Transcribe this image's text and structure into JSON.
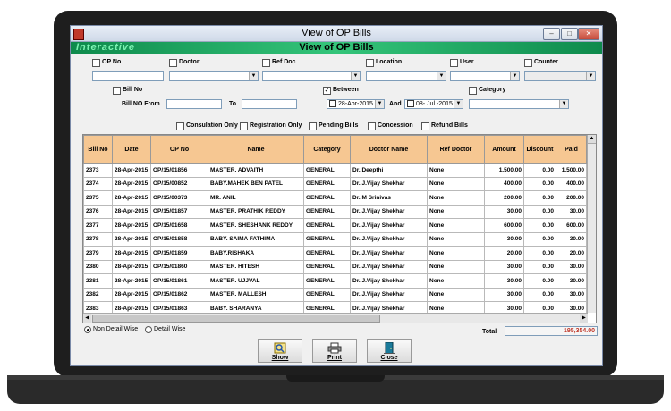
{
  "window": {
    "title": "View of OP Bills"
  },
  "banner": {
    "brand": "Interactive",
    "title": "View of  OP Bills"
  },
  "filters": {
    "op_no": "OP No",
    "doctor": "Doctor",
    "ref_doc": "Ref Doc",
    "location": "Location",
    "user": "User",
    "counter": "Counter",
    "bill_no": "Bill No",
    "bill_no_from": "Bill NO   From",
    "to": "To",
    "between": "Between",
    "date_from": "28-Apr-2015",
    "and": "And",
    "date_to": "08- Jul -2015",
    "category": "Category",
    "consultation_only": "Consulation Only",
    "registration_only": "Registration Only",
    "pending_bills": "Pending Bills",
    "concession": "Concession",
    "refund_bills": "Refund Bills"
  },
  "table": {
    "headers": [
      "Bill No",
      "Date",
      "OP No",
      "Name",
      "Category",
      "Doctor Name",
      "Ref Doctor",
      "Amount",
      "Discount",
      "Paid"
    ],
    "rows": [
      [
        "2373",
        "28-Apr-2015",
        "OP/15/01856",
        "MASTER. ADVAITH",
        "GENERAL",
        "Dr. Deepthi",
        "None",
        "1,500.00",
        "0.00",
        "1,500.00"
      ],
      [
        "2374",
        "28-Apr-2015",
        "OP/15/00852",
        "BABY.MAHEK BEN PATEL",
        "GENERAL",
        "Dr. J.Vijay Shekhar",
        "None",
        "400.00",
        "0.00",
        "400.00"
      ],
      [
        "2375",
        "28-Apr-2015",
        "OP/15/00373",
        "MR. ANIL",
        "GENERAL",
        "Dr. M Srinivas",
        "None",
        "200.00",
        "0.00",
        "200.00"
      ],
      [
        "2376",
        "28-Apr-2015",
        "OP/15/01857",
        "MASTER. PRATHIK REDDY",
        "GENERAL",
        "Dr. J.Vijay Shekhar",
        "None",
        "30.00",
        "0.00",
        "30.00"
      ],
      [
        "2377",
        "28-Apr-2015",
        "OP/15/01658",
        "MASTER. SHESHANK REDDY",
        "GENERAL",
        "Dr. J.Vijay Shekhar",
        "None",
        "600.00",
        "0.00",
        "600.00"
      ],
      [
        "2378",
        "28-Apr-2015",
        "OP/15/01858",
        "BABY. SAIMA FATHIMA",
        "GENERAL",
        "Dr. J.Vijay Shekhar",
        "None",
        "30.00",
        "0.00",
        "30.00"
      ],
      [
        "2379",
        "28-Apr-2015",
        "OP/15/01859",
        "BABY.RISHAKA",
        "GENERAL",
        "Dr. J.Vijay Shekhar",
        "None",
        "20.00",
        "0.00",
        "20.00"
      ],
      [
        "2380",
        "28-Apr-2015",
        "OP/15/01860",
        "MASTER. HITESH",
        "GENERAL",
        "Dr. J.Vijay Shekhar",
        "None",
        "30.00",
        "0.00",
        "30.00"
      ],
      [
        "2381",
        "28-Apr-2015",
        "OP/15/01861",
        "MASTER. UJJVAL",
        "GENERAL",
        "Dr. J.Vijay Shekhar",
        "None",
        "30.00",
        "0.00",
        "30.00"
      ],
      [
        "2382",
        "28-Apr-2015",
        "OP/15/01862",
        "MASTER. MALLESH",
        "GENERAL",
        "Dr. J.Vijay Shekhar",
        "None",
        "30.00",
        "0.00",
        "30.00"
      ],
      [
        "2383",
        "28-Apr-2015",
        "OP/15/01863",
        "BABY. SHARANYA",
        "GENERAL",
        "Dr. J.Vijay Shekhar",
        "None",
        "30.00",
        "0.00",
        "30.00"
      ]
    ]
  },
  "footer": {
    "non_detail": "Non Detail Wise",
    "detail": "Detail Wise",
    "total_label": "Total",
    "total_value": "195,354.00"
  },
  "buttons": {
    "show": "Show",
    "print": "Print",
    "close": "Close"
  },
  "colors": {
    "header_bg": "#f6c792",
    "banner": "#1aa45f",
    "total_text": "#c0392b"
  }
}
